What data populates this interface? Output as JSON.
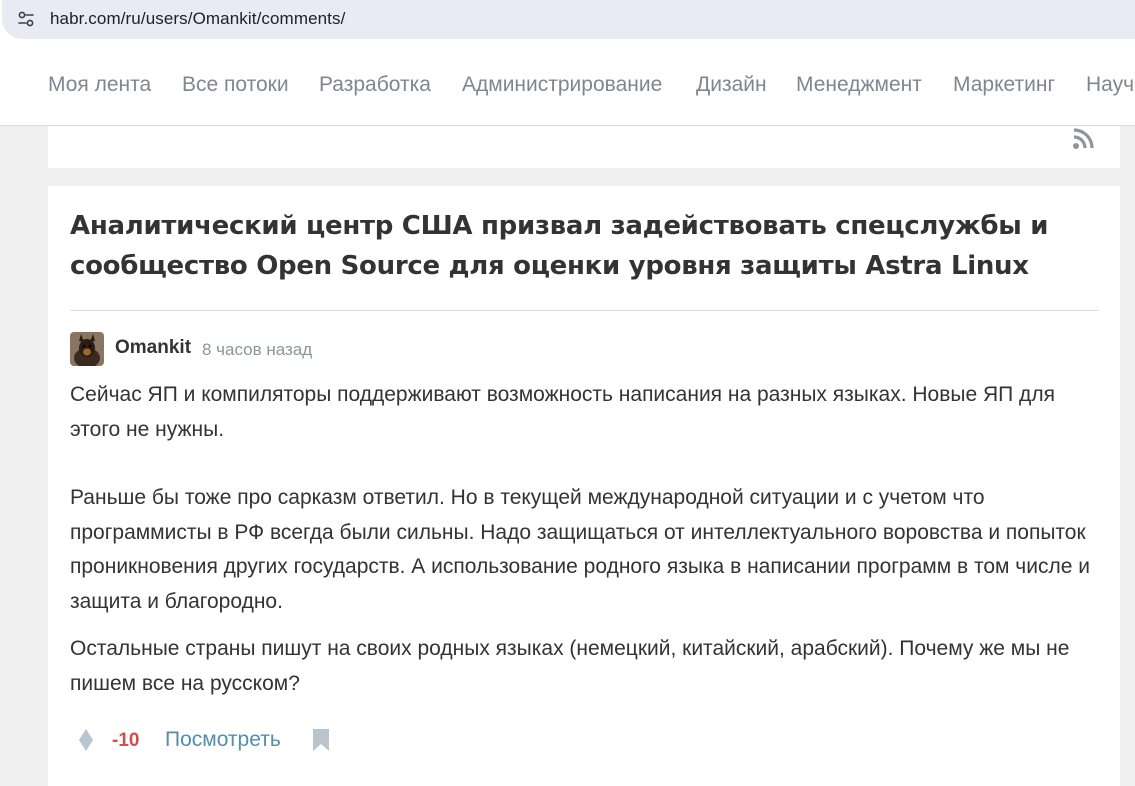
{
  "browser": {
    "url": "habr.com/ru/users/Omankit/comments/",
    "site_info_icon": "tune-icon"
  },
  "nav": {
    "items": [
      "Моя лента",
      "Все потоки",
      "Разработка",
      "Администрирование",
      "Дизайн",
      "Менеджмент",
      "Маркетинг",
      "Научпоп"
    ]
  },
  "feed": {
    "rss_icon": "rss-icon"
  },
  "comment": {
    "post_title": "Аналитический центр США призвал задействовать спецслужбы и сообщество Open Source для оценки уровня защиты Astra Linux",
    "author": "Omankit",
    "time": "8 часов назад",
    "paragraphs": [
      "Сейчас ЯП и компиляторы поддерживают возможность написания на разных языках. Новые ЯП для этого не нужны.",
      "Раньше бы тоже про сарказм ответил. Но в текущей международной ситуации и с учетом что программисты в РФ всегда были сильны. Надо защищаться от интеллектуального воровства и попыток проникновения других государств. А использование родного языка в написании программ в том числе и защита и благородно.",
      "Остальные страны пишут на своих родных языках (немецкий, китайский, арабский). Почему же мы не пишем все на русском?"
    ],
    "score": "-10",
    "view_label": "Посмотреть",
    "icons": {
      "vote": "vote-icon",
      "bookmark": "bookmark-icon",
      "avatar": "avatar"
    }
  },
  "colors": {
    "nav_text": "#7e8790",
    "title_text": "#333333",
    "score_negative": "#d04e4e",
    "link": "#548eaa",
    "page_bg": "#f0f0f0"
  }
}
